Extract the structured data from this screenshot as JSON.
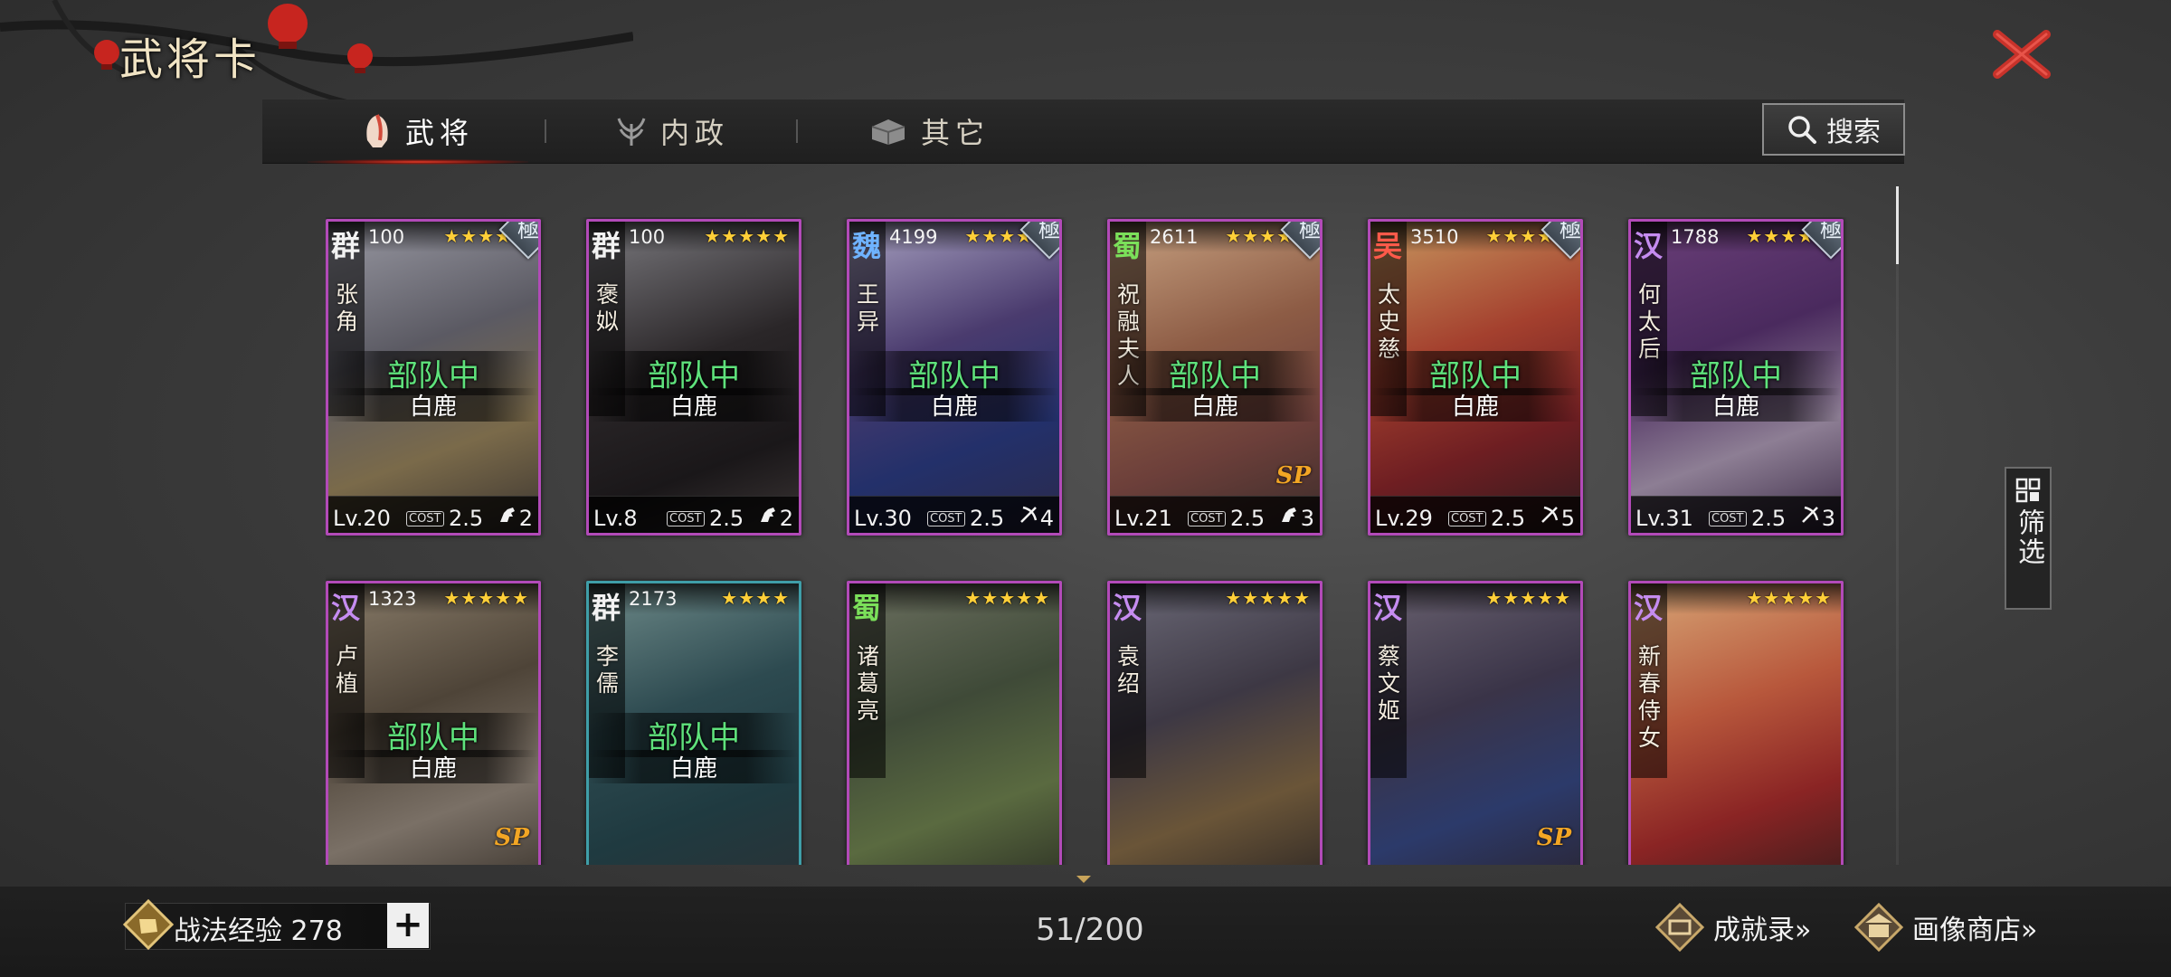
{
  "title": "武将卡",
  "tabs": [
    {
      "label": "武将",
      "icon": "helmet-icon",
      "active": true
    },
    {
      "label": "内政",
      "icon": "plant-icon",
      "active": false
    },
    {
      "label": "其它",
      "icon": "box-icon",
      "active": false
    }
  ],
  "search_label": "搜索",
  "filter_label": "筛选",
  "cards": [
    {
      "faction": "群",
      "faction_color": "#f2f2f2",
      "power": "100",
      "stars": "★★★★★",
      "name": "张角",
      "grade": "極",
      "in_troop": "部队中",
      "troop": "白鹿",
      "level": "Lv.20",
      "cost_label": "COST",
      "cost": "2.5",
      "unit": "horse-icon",
      "unit_count": "2",
      "border": "purple",
      "bg": "linear-gradient(160deg,#9a9aa4 0%,#5b5a63 40%,#7a6a4a 70%,#3c3530 100%)"
    },
    {
      "faction": "群",
      "faction_color": "#f2f2f2",
      "power": "100",
      "stars": "★★★★★",
      "name": "褒姒",
      "grade": "",
      "in_troop": "部队中",
      "troop": "白鹿",
      "level": "Lv.8",
      "cost_label": "COST",
      "cost": "2.5",
      "unit": "horse-icon",
      "unit_count": "2",
      "border": "purple",
      "bg": "linear-gradient(160deg,#7c7b80 0%,#2a2628 45%,#1a1719 75%,#3b3535 100%)"
    },
    {
      "faction": "魏",
      "faction_color": "#6fb3ff",
      "power": "4199",
      "stars": "★★★★★",
      "name": "王异",
      "grade": "極",
      "in_troop": "部队中",
      "troop": "白鹿",
      "level": "Lv.30",
      "cost_label": "COST",
      "cost": "2.5",
      "unit": "bow-icon",
      "unit_count": "4",
      "border": "purple",
      "bg": "linear-gradient(160deg,#a9a3c2 0%,#4a3b6e 40%,#23306a 70%,#2b2a4a 100%)"
    },
    {
      "faction": "蜀",
      "faction_color": "#7be05a",
      "power": "2611",
      "stars": "★★★★★",
      "name": "祝融夫人",
      "grade": "極",
      "in_troop": "部队中",
      "troop": "白鹿",
      "level": "Lv.21",
      "cost_label": "COST",
      "cost": "2.5",
      "unit": "horse-icon",
      "unit_count": "3",
      "border": "purple",
      "bg": "linear-gradient(160deg,#c8a282 0%,#8d5c45 40%,#6c3f3a 70%,#3a2c2a 100%)",
      "sp": "SP"
    },
    {
      "faction": "吴",
      "faction_color": "#ff5a4a",
      "power": "3510",
      "stars": "★★★★★",
      "name": "太史慈",
      "grade": "極",
      "in_troop": "部队中",
      "troop": "白鹿",
      "level": "Lv.29",
      "cost_label": "COST",
      "cost": "2.5",
      "unit": "bow-icon",
      "unit_count": "5",
      "border": "purple",
      "bg": "linear-gradient(160deg,#c89960 0%,#a4402e 40%,#6e1e22 70%,#2f1b1e 100%)"
    },
    {
      "faction": "汉",
      "faction_color": "#c58cf0",
      "power": "1788",
      "stars": "★★★★★",
      "name": "何太后",
      "grade": "極",
      "in_troop": "部队中",
      "troop": "白鹿",
      "level": "Lv.31",
      "cost_label": "COST",
      "cost": "2.5",
      "unit": "bow-icon",
      "unit_count": "3",
      "border": "purple",
      "bg": "linear-gradient(160deg,#6b3f79 0%,#4a2a5e 40%,#8d7e94 70%,#3a2a45 100%)"
    },
    {
      "faction": "汉",
      "faction_color": "#c58cf0",
      "power": "1323",
      "stars": "★★★★★",
      "name": "卢植",
      "grade": "",
      "in_troop": "部队中",
      "troop": "白鹿",
      "level": "",
      "cost_label": "",
      "cost": "",
      "unit": "horse-icon",
      "unit_count": "",
      "border": "purple",
      "bg": "linear-gradient(160deg,#8a7d6a 0%,#4e4438 40%,#7a7066 70%,#3a332c 100%)",
      "sp": "SP"
    },
    {
      "faction": "群",
      "faction_color": "#f2f2f2",
      "power": "2173",
      "stars": "★★★★",
      "name": "李儒",
      "grade": "",
      "in_troop": "部队中",
      "troop": "白鹿",
      "level": "",
      "cost_label": "",
      "cost": "",
      "unit": "bow-icon",
      "unit_count": "",
      "border": "blue",
      "bg": "linear-gradient(160deg,#6f8b8a 0%,#2d4a50 40%,#1f3a40 70%,#2a3236 100%)"
    },
    {
      "faction": "蜀",
      "faction_color": "#7be05a",
      "power": "",
      "stars": "★★★★★",
      "name": "诸葛亮",
      "grade": "",
      "in_troop": "",
      "troop": "",
      "level": "",
      "cost_label": "",
      "cost": "",
      "unit": "horse-icon",
      "unit_count": "",
      "border": "purple",
      "bg": "linear-gradient(160deg,#6c7060 0%,#3f4a38 40%,#5a6a40 70%,#2c3024 100%)"
    },
    {
      "faction": "汉",
      "faction_color": "#c58cf0",
      "power": "",
      "stars": "★★★★★",
      "name": "袁绍",
      "grade": "",
      "in_troop": "",
      "troop": "",
      "level": "",
      "cost_label": "",
      "cost": "",
      "unit": "horse-icon",
      "unit_count": "",
      "border": "purple",
      "bg": "linear-gradient(160deg,#6c6a78 0%,#3d3844 40%,#6a5538 70%,#2c2624 100%)"
    },
    {
      "faction": "汉",
      "faction_color": "#c58cf0",
      "power": "",
      "stars": "★★★★★",
      "name": "蔡文姬",
      "grade": "",
      "in_troop": "",
      "troop": "",
      "level": "",
      "cost_label": "",
      "cost": "",
      "unit": "horse-icon",
      "unit_count": "",
      "border": "purple",
      "bg": "linear-gradient(160deg,#6a6270 0%,#3a3448 40%,#2c3a6a 70%,#2a2430 100%)",
      "sp": "SP"
    },
    {
      "faction": "汉",
      "faction_color": "#c58cf0",
      "power": "",
      "stars": "★★★★★",
      "name": "新春侍女",
      "grade": "",
      "in_troop": "",
      "troop": "",
      "level": "",
      "cost_label": "",
      "cost": "",
      "unit": "bow-icon",
      "unit_count": "",
      "border": "purple",
      "bg": "linear-gradient(160deg,#d8a878 0%,#b8583c 40%,#8a2424 70%,#3a1c1c 100%)"
    }
  ],
  "bottom": {
    "exp_label": "战法经验 278",
    "exp_plus": "+",
    "count": "51/200",
    "achievements": "成就录»",
    "portrait_shop": "画像商店»"
  }
}
